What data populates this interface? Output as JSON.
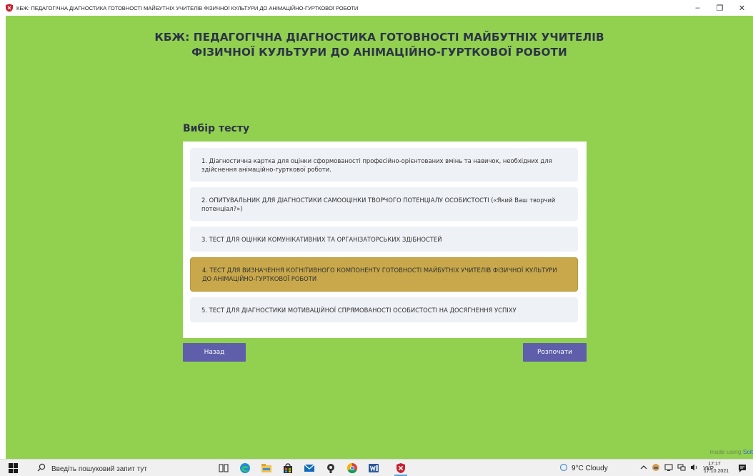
{
  "window": {
    "title": "КБЖ: ПЕДАГОГІЧНА ДІАГНОСТИКА ГОТОВНОСТІ МАЙБУТНІХ УЧИТЕЛІВ ФІЗИЧНОЇ КУЛЬТУРИ ДО АНІМАЦІЙНО-ГУРТКОВОЇ РОБОТИ",
    "minimize_glyph": "–",
    "maximize_glyph": "❐",
    "close_glyph": "✕"
  },
  "header": {
    "line1": "КБЖ: ПЕДАГОГІЧНА ДІАГНОСТИКА ГОТОВНОСТІ МАЙБУТНІХ УЧИТЕЛІВ",
    "line2": "ФІЗИЧНОЇ КУЛЬТУРИ ДО АНІМАЦІЙНО-ГУРТКОВОЇ РОБОТИ"
  },
  "test_selection": {
    "title": "Вибір тесту",
    "items": [
      {
        "label": "1. Діагностична картка для оцінки сформованості професійно-орієнтованих вмінь та навичок, необхідних для здійснення анімаційно-гурткової роботи.",
        "selected": false
      },
      {
        "label": "2. ОПИТУВАЛЬНИК ДЛЯ ДІАГНОСТИКИ САМООЦІНКИ ТВОРЧОГО ПОТЕНЦІАЛУ ОСОБИСТОСТІ («Який Ваш творчий потенціал?»)",
        "selected": false
      },
      {
        "label": "3. ТЕСТ ДЛЯ ОЦІНКИ КОМУНІКАТИВНИХ ТА ОРГАНІЗАТОРСЬКИХ ЗДІБНОСТЕЙ",
        "selected": false
      },
      {
        "label": "4. ТЕСТ ДЛЯ ВИЗНАЧЕННЯ КОГНІТИВНОГО КОМПОНЕНТУ ГОТОВНОСТІ МАЙБУТНІХ УЧИТЕЛІВ ФІЗИЧНОЇ КУЛЬТУРИ ДО АНІМАЦІЙНО-ГУРТКОВОЇ РОБОТИ",
        "selected": true
      },
      {
        "label": "5. ТЕСТ ДЛЯ ДІАГНОСТИКИ МОТИВАЦІЙНОЇ СПРЯМОВАНОСТІ ОСОБИСТОСТІ НА ДОСЯГНЕННЯ УСПІХУ",
        "selected": false
      }
    ]
  },
  "buttons": {
    "back": "Назад",
    "start": "Розпочати"
  },
  "footer": {
    "made_using": "made using ",
    "made_using_link": "Scit"
  },
  "taskbar": {
    "search_placeholder": "Введіть пошуковий запит тут",
    "weather": "9°C  Cloudy",
    "language": "УКР",
    "time": "17:17",
    "date": "17.10.2021"
  },
  "colors": {
    "app_background": "#92d050",
    "item_background": "#eef1f6",
    "item_selected": "#c8a84b",
    "button": "#5e5eaa",
    "header_text": "#2c3447"
  },
  "icons": {
    "app": "shield-icon",
    "start": "windows-logo-icon",
    "search": "search-icon",
    "task_view": "task-view-icon",
    "edge": "edge-browser-icon",
    "explorer": "file-explorer-icon",
    "store": "store-icon",
    "mail": "mail-icon",
    "tool": "tool-app-icon",
    "chrome": "chrome-icon",
    "word": "word-icon",
    "shield_app": "shield-app-icon",
    "notifications": "notification-icon"
  }
}
